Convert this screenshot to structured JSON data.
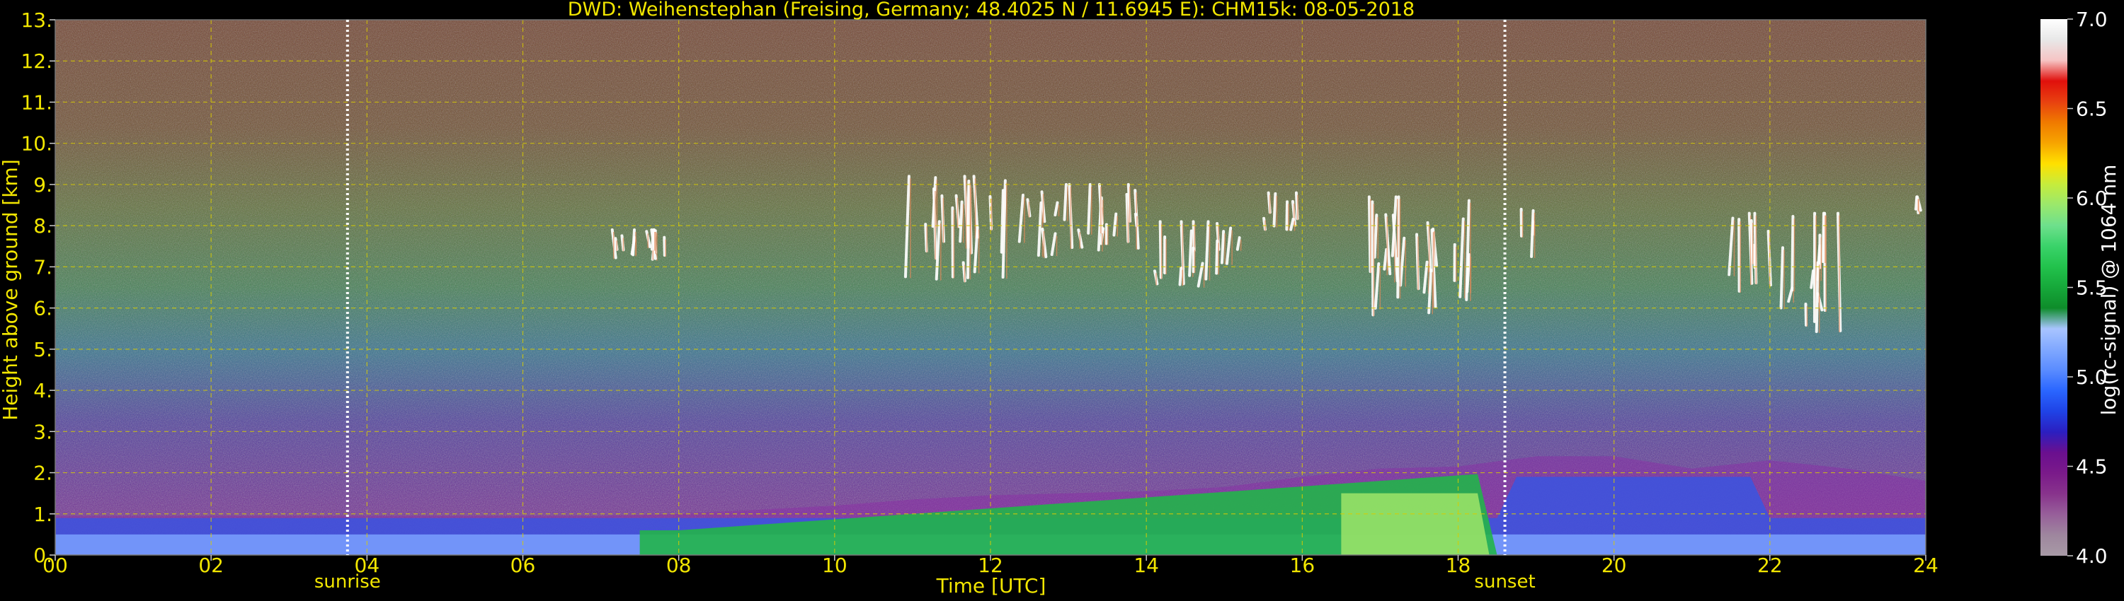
{
  "chart_data": {
    "type": "heatmap",
    "title": "DWD: Weihenstephan (Freising, Germany; 48.4025 N / 11.6945 E):    CHM15k: 08-05-2018",
    "xlabel": "Time [UTC]",
    "ylabel": "Height above ground [km]",
    "xlim": [
      0,
      24
    ],
    "ylim": [
      0,
      13
    ],
    "x_ticks": [
      0,
      2,
      4,
      6,
      8,
      10,
      12,
      14,
      16,
      18,
      20,
      22,
      24
    ],
    "x_tick_labels": [
      "00",
      "02",
      "04",
      "06",
      "08",
      "10",
      "12",
      "14",
      "16",
      "18",
      "20",
      "22",
      "24"
    ],
    "y_ticks": [
      0,
      1,
      2,
      3,
      4,
      5,
      6,
      7,
      8,
      9,
      10,
      11,
      12,
      13
    ],
    "y_tick_labels": [
      "0.",
      "1.",
      "2.",
      "3.",
      "4.",
      "5.",
      "6.",
      "7.",
      "8.",
      "9.",
      "10.",
      "11.",
      "12.",
      "13."
    ],
    "grid": true,
    "markers": [
      {
        "label": "sunrise",
        "time": 3.75
      },
      {
        "label": "sunset",
        "time": 18.6
      }
    ],
    "colorbar": {
      "label": "log(rc-signal) @ 1064 nm",
      "min": 4.0,
      "max": 7.0,
      "ticks": [
        4.0,
        4.5,
        5.0,
        5.5,
        6.0,
        6.5,
        7.0
      ],
      "tick_labels": [
        "4.0",
        "4.5",
        "5.0",
        "5.5",
        "6.0",
        "6.5",
        "7.0"
      ],
      "colors": [
        "#a89aa6",
        "#9e869e",
        "#975f9a",
        "#88338c",
        "#7a1a8a",
        "#6a0f8f",
        "#2b1fc0",
        "#1f43e6",
        "#2a66ff",
        "#5a8cff",
        "#80a8ff",
        "#a8c4ff",
        "#0e8c2a",
        "#16a83a",
        "#22c24c",
        "#3ad36a",
        "#6ee08c",
        "#9ae86c",
        "#c6ec3c",
        "#ffe000",
        "#f7a400",
        "#f07a00",
        "#e84010",
        "#e0100c",
        "#f6c4c4",
        "#e8e8e8",
        "#ffffff"
      ]
    },
    "boundary_layer": {
      "x": [
        0,
        1,
        2,
        3,
        4,
        5,
        6,
        7,
        8,
        9,
        10,
        11,
        12,
        13,
        14,
        15,
        16,
        17,
        18,
        19,
        20,
        21,
        22,
        23,
        24
      ],
      "top_km": [
        0.95,
        0.95,
        0.95,
        0.95,
        0.95,
        0.95,
        0.95,
        0.95,
        1.0,
        1.1,
        1.2,
        1.35,
        1.45,
        1.5,
        1.55,
        1.65,
        1.9,
        2.1,
        2.15,
        2.4,
        2.4,
        2.1,
        2.3,
        2.1,
        1.8
      ]
    },
    "cloud_layers": [
      {
        "x0": 7.1,
        "x1": 7.85,
        "base_km": 7.0,
        "top_km": 7.9
      },
      {
        "x0": 10.9,
        "x1": 12.2,
        "base_km": 6.6,
        "top_km": 9.2
      },
      {
        "x0": 12.4,
        "x1": 13.9,
        "base_km": 7.2,
        "top_km": 9.0
      },
      {
        "x0": 14.1,
        "x1": 15.2,
        "base_km": 6.5,
        "top_km": 8.1
      },
      {
        "x0": 15.5,
        "x1": 16.0,
        "base_km": 7.9,
        "top_km": 8.8
      },
      {
        "x0": 16.8,
        "x1": 18.2,
        "base_km": 5.8,
        "top_km": 8.7
      },
      {
        "x0": 18.8,
        "x1": 19.0,
        "base_km": 7.2,
        "top_km": 8.4
      },
      {
        "x0": 21.5,
        "x1": 22.9,
        "base_km": 5.4,
        "top_km": 8.3
      },
      {
        "x0": 23.85,
        "x1": 23.95,
        "base_km": 8.3,
        "top_km": 8.7
      }
    ]
  }
}
